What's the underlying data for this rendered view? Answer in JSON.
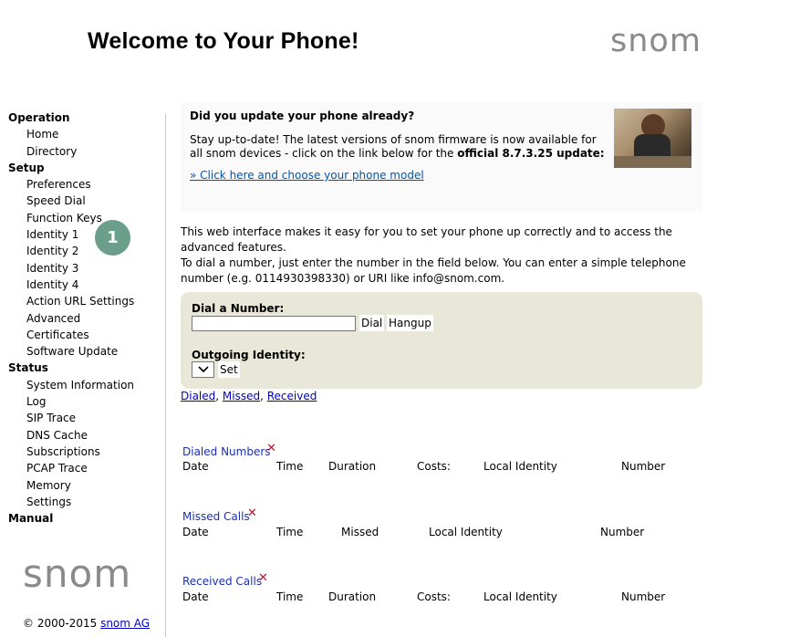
{
  "header": {
    "title": "Welcome to Your Phone!",
    "logo_text": "snom"
  },
  "sidebar": {
    "sections": [
      {
        "label": "Operation",
        "items": [
          "Home",
          "Directory"
        ]
      },
      {
        "label": "Setup",
        "items": [
          "Preferences",
          "Speed Dial",
          "Function Keys",
          "Identity 1",
          "Identity 2",
          "Identity 3",
          "Identity 4",
          "Action URL Settings",
          "Advanced",
          "Certificates",
          "Software Update"
        ]
      },
      {
        "label": "Status",
        "items": [
          "System Information",
          "Log",
          "SIP Trace",
          "DNS Cache",
          "Subscriptions",
          "PCAP Trace",
          "Memory",
          "Settings"
        ]
      },
      {
        "label": "Manual",
        "items": []
      }
    ],
    "badge": "1",
    "logo_text": "snom",
    "copyright_prefix": "© 2000-2015",
    "copyright_link": "snom AG"
  },
  "update": {
    "title": "Did you update your phone already?",
    "text_plain": "Stay up-to-date! The latest versions of snom firmware is now available for all snom devices - click on the link below for the",
    "text_bold": "official 8.7.3.25 update:",
    "link": "» Click here and choose your phone model"
  },
  "intro": {
    "line1": "This web interface makes it easy for you to set your phone up correctly and to access the advanced features.",
    "line2": "To dial a number, just enter the number in the field below. You can enter a simple telephone number (e.g. 0114930398330) or URI like info@snom.com."
  },
  "dial": {
    "label": "Dial a Number:",
    "value": "",
    "dial_button": "Dial",
    "hangup_button": "Hangup",
    "identity_label": "Outgoing Identity:",
    "identity_value": "",
    "set_button": "Set"
  },
  "call_links": [
    "Dialed",
    "Missed",
    "Received"
  ],
  "lists": {
    "dialed": {
      "title": "Dialed Numbers",
      "columns": [
        "Date",
        "Time",
        "Duration",
        "Costs:",
        "Local Identity",
        "Number"
      ]
    },
    "missed": {
      "title": "Missed Calls",
      "columns": [
        "Date",
        "Time",
        "Missed",
        "Local Identity",
        "Number"
      ]
    },
    "received": {
      "title": "Received Calls",
      "columns": [
        "Date",
        "Time",
        "Duration",
        "Costs:",
        "Local Identity",
        "Number"
      ]
    }
  },
  "icons": {
    "delete": "close-icon",
    "select": "chevron-down-icon"
  },
  "colors": {
    "logo": "#8a8a8a",
    "badge": "#6c9f8b",
    "dial_box": "#e9e7d8",
    "link": "#0000cc",
    "list_title": "#1a2fb0",
    "delete_icon": "#c4102a"
  }
}
